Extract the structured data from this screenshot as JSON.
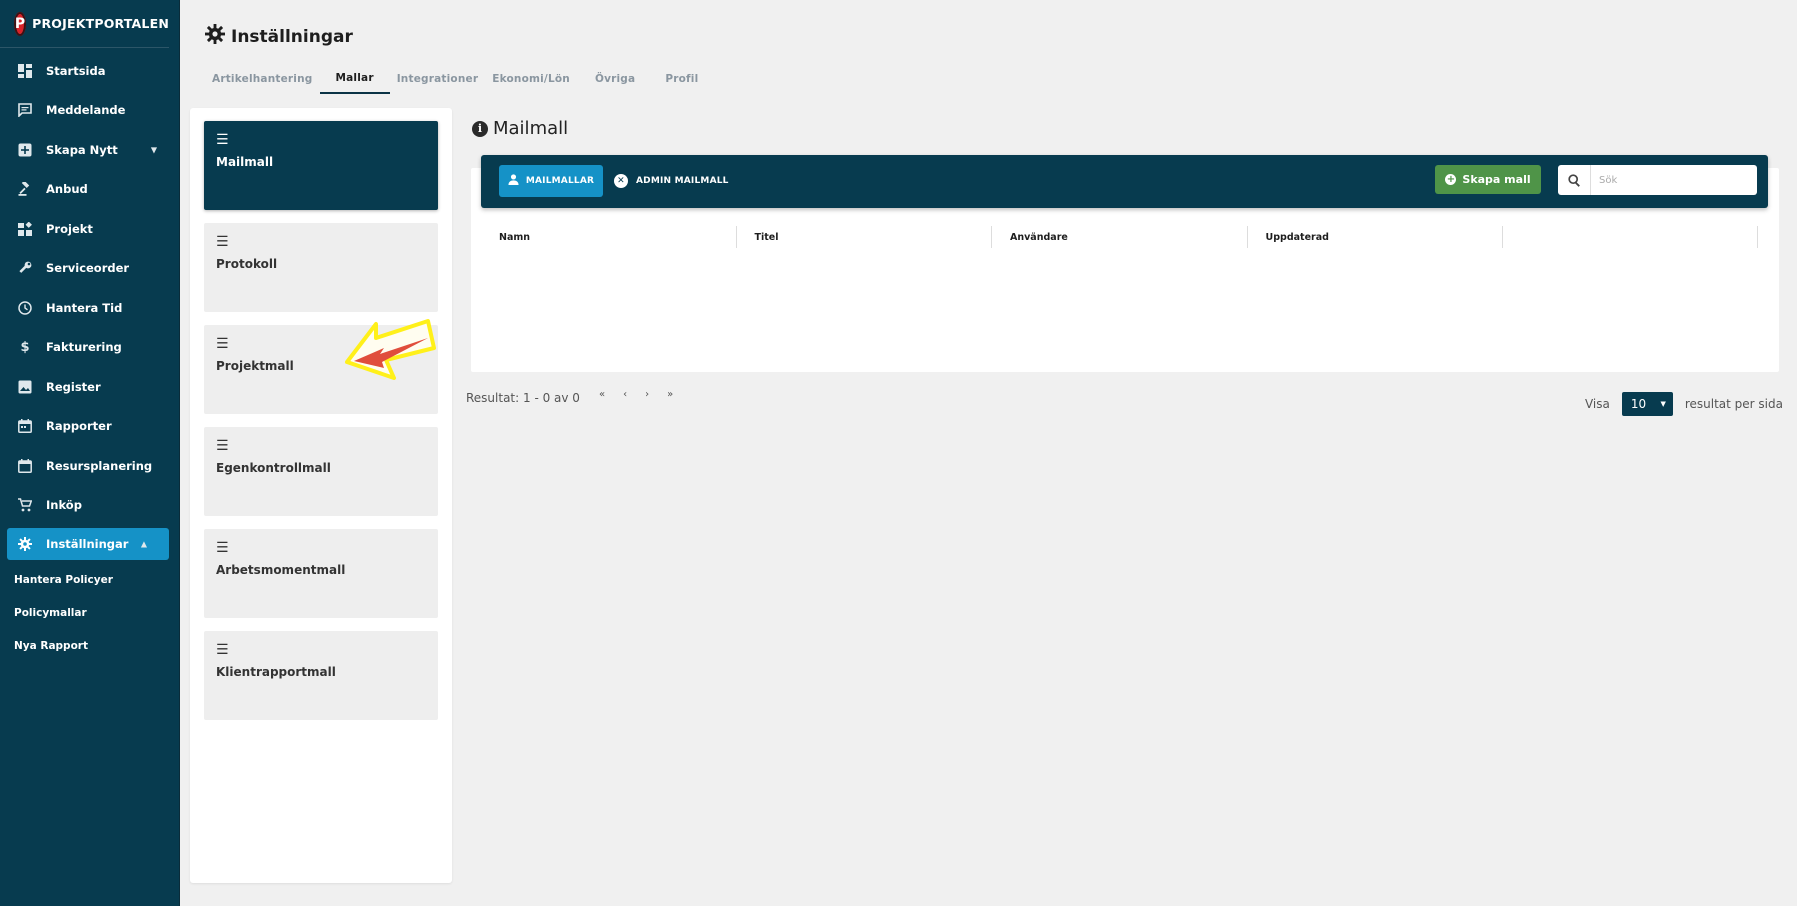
{
  "app": {
    "brand_initial": "P",
    "brand_name": "PROJEKTPORTALEN"
  },
  "sidebar": {
    "items": [
      {
        "label": "Startsida",
        "icon": "dashboard-icon"
      },
      {
        "label": "Meddelande",
        "icon": "message-icon"
      },
      {
        "label": "Skapa Nytt",
        "icon": "add-box-icon"
      },
      {
        "label": "Anbud",
        "icon": "gavel-icon"
      },
      {
        "label": "Projekt",
        "icon": "widgets-icon"
      },
      {
        "label": "Serviceorder",
        "icon": "wrench-icon"
      },
      {
        "label": "Hantera Tid",
        "icon": "clock-icon"
      },
      {
        "label": "Fakturering",
        "icon": "dollar-icon"
      },
      {
        "label": "Register",
        "icon": "image-icon"
      },
      {
        "label": "Rapporter",
        "icon": "calendar-icon"
      },
      {
        "label": "Resursplanering",
        "icon": "calendar-blank-icon"
      },
      {
        "label": "Inköp",
        "icon": "cart-icon"
      },
      {
        "label": "Inställningar",
        "icon": "gear-icon"
      }
    ],
    "sub_items": [
      {
        "label": "Hantera Policyer"
      },
      {
        "label": "Policymallar"
      },
      {
        "label": "Nya Rapport"
      }
    ]
  },
  "header": {
    "title": "Inställningar",
    "tabs": [
      {
        "label": "Artikelhantering"
      },
      {
        "label": "Mallar"
      },
      {
        "label": "Integrationer"
      },
      {
        "label": "Ekonomi/Lön"
      },
      {
        "label": "Övriga"
      },
      {
        "label": "Profil"
      }
    ]
  },
  "templates": [
    {
      "label": "Mailmall"
    },
    {
      "label": "Protokoll"
    },
    {
      "label": "Projektmall"
    },
    {
      "label": "Egenkontrollmall"
    },
    {
      "label": "Arbetsmomentmall"
    },
    {
      "label": "Klientrapportmall"
    }
  ],
  "main": {
    "title": "Mailmall",
    "info_glyph": "i",
    "toolbar": {
      "mailmallar_label": "MAILMALLAR",
      "admin_label": "ADMIN MAILMALL",
      "create_label": "Skapa mall",
      "search_placeholder": "Sök"
    },
    "columns": [
      "Namn",
      "Titel",
      "Användare",
      "Uppdaterad",
      ""
    ],
    "pagination": {
      "result_text": "Resultat: 1 - 0 av 0",
      "first": "«",
      "prev": "‹",
      "next": "›",
      "last": "»"
    },
    "per_page": {
      "show_label": "Visa",
      "value": "10",
      "suffix": "resultat per sida"
    }
  },
  "colors": {
    "sidebar_bg": "#073b4f",
    "accent": "#1592c7",
    "create_green": "#4f9448",
    "annotation_yellow": "#fff01a",
    "annotation_red": "#e04e3c"
  }
}
